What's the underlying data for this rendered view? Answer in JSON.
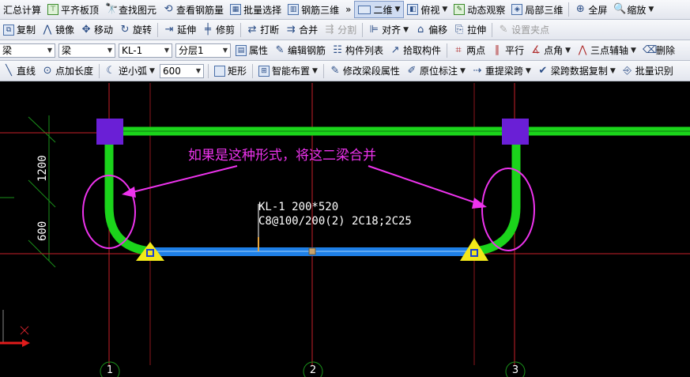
{
  "toolbar1": {
    "items": [
      {
        "label": "汇总计算",
        "icon": "sum-icon"
      },
      {
        "label": "平齐板顶",
        "icon": "align-top-icon"
      },
      {
        "label": "查找图元",
        "icon": "find-icon"
      },
      {
        "label": "查看钢筋量",
        "icon": "rebar-view-icon"
      },
      {
        "label": "批量选择",
        "icon": "batch-select-icon"
      },
      {
        "label": "钢筋三维",
        "icon": "rebar-3d-icon"
      },
      {
        "label": "二维",
        "icon": "2d-icon"
      },
      {
        "label": "俯视",
        "icon": "top-view-icon"
      },
      {
        "label": "动态观察",
        "icon": "orbit-icon"
      },
      {
        "label": "局部三维",
        "icon": "local-3d-icon"
      },
      {
        "label": "全屏",
        "icon": "fullscreen-icon"
      },
      {
        "label": "缩放",
        "icon": "zoom-icon"
      }
    ]
  },
  "toolbar2": {
    "items": [
      {
        "label": "复制",
        "icon": "copy-icon"
      },
      {
        "label": "镜像",
        "icon": "mirror-icon"
      },
      {
        "label": "移动",
        "icon": "move-icon"
      },
      {
        "label": "旋转",
        "icon": "rotate-icon"
      },
      {
        "label": "延伸",
        "icon": "extend-icon"
      },
      {
        "label": "修剪",
        "icon": "trim-icon"
      },
      {
        "label": "打断",
        "icon": "break-icon"
      },
      {
        "label": "合并",
        "icon": "merge-icon"
      },
      {
        "label": "分割",
        "icon": "split-icon"
      },
      {
        "label": "对齐",
        "icon": "align-icon"
      },
      {
        "label": "偏移",
        "icon": "offset-icon"
      },
      {
        "label": "拉伸",
        "icon": "stretch-icon"
      },
      {
        "label": "设置夹点",
        "icon": "grip-icon"
      }
    ]
  },
  "toolbar3": {
    "combo1": "梁",
    "combo2": "梁",
    "combo3": "KL-1",
    "combo4": "分层1",
    "items": [
      {
        "label": "属性",
        "icon": "properties-icon"
      },
      {
        "label": "编辑钢筋",
        "icon": "edit-rebar-icon"
      },
      {
        "label": "构件列表",
        "icon": "component-list-icon"
      },
      {
        "label": "拾取构件",
        "icon": "pick-icon"
      },
      {
        "label": "两点",
        "icon": "two-point-icon"
      },
      {
        "label": "平行",
        "icon": "parallel-icon"
      },
      {
        "label": "点角",
        "icon": "point-angle-icon"
      },
      {
        "label": "三点辅轴",
        "icon": "three-point-axis-icon"
      },
      {
        "label": "删除",
        "icon": "delete-icon"
      }
    ]
  },
  "toolbar4": {
    "items": [
      {
        "label": "直线",
        "icon": "line-icon"
      },
      {
        "label": "点加长度",
        "icon": "point-length-icon"
      },
      {
        "label": "逆小弧",
        "icon": "arc-icon"
      }
    ],
    "radius_value": "600",
    "items2": [
      {
        "label": "矩形",
        "icon": "rectangle-icon"
      },
      {
        "label": "智能布置",
        "icon": "smart-layout-icon"
      },
      {
        "label": "修改梁段属性",
        "icon": "modify-beam-icon"
      },
      {
        "label": "原位标注",
        "icon": "in-place-mark-icon"
      },
      {
        "label": "重提梁跨",
        "icon": "respan-icon"
      },
      {
        "label": "梁跨数据复制",
        "icon": "copy-span-icon"
      },
      {
        "label": "批量识别",
        "icon": "batch-recognize-icon"
      }
    ]
  },
  "drawing": {
    "annotation": "如果是这种形式，将这二梁合并",
    "beam_name": "KL-1 200*520",
    "beam_rebar": "C8@100/200(2) 2C18;2C25",
    "dim_upper": "1200",
    "dim_lower": "600",
    "axis_labels": [
      "1",
      "2",
      "3"
    ],
    "colors": {
      "beam_green": "#1bd41b",
      "beam_blue": "#1e7fe6",
      "column_purple": "#6a1fd6",
      "support_yellow": "#f2e81a",
      "grid_red": "#c8202a",
      "annotation_magenta": "#ee33ee"
    }
  }
}
